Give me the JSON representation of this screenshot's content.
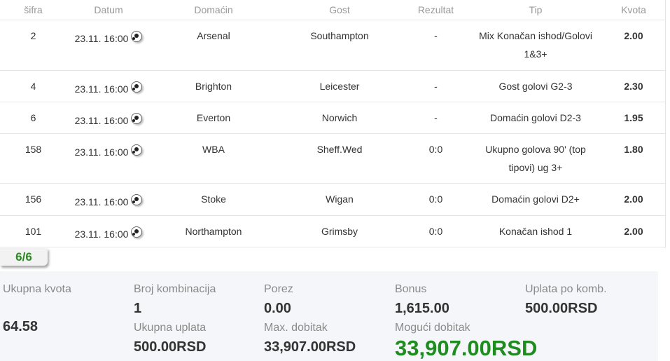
{
  "table": {
    "headers": [
      "šifra",
      "Datum",
      "Domaćin",
      "Gost",
      "Rezultat",
      "Tip",
      "Kvota"
    ],
    "rows": [
      {
        "code": "2",
        "date": "23.11. 16:00",
        "home": "Arsenal",
        "away": "Southampton",
        "result": "-",
        "tip": "Mix Konačan ishod/Golovi 1&3+",
        "odds": "2.00"
      },
      {
        "code": "4",
        "date": "23.11. 16:00",
        "home": "Brighton",
        "away": "Leicester",
        "result": "-",
        "tip": "Gost golovi G2-3",
        "odds": "2.30"
      },
      {
        "code": "6",
        "date": "23.11. 16:00",
        "home": "Everton",
        "away": "Norwich",
        "result": "-",
        "tip": "Domaćin golovi D2-3",
        "odds": "1.95"
      },
      {
        "code": "158",
        "date": "23.11. 16:00",
        "home": "WBA",
        "away": "Sheff.Wed",
        "result": "0:0",
        "tip": "Ukupno golova 90' (top tipovi) ug 3+",
        "odds": "1.80"
      },
      {
        "code": "156",
        "date": "23.11. 16:00",
        "home": "Stoke",
        "away": "Wigan",
        "result": "0:0",
        "tip": "Domaćin golovi D2+",
        "odds": "2.00"
      },
      {
        "code": "101",
        "date": "23.11. 16:00",
        "home": "Northampton",
        "away": "Grimsby",
        "result": "0:0",
        "tip": "Konačan ishod 1",
        "odds": "2.00"
      }
    ]
  },
  "counter": "6/6",
  "summary": {
    "total_odds_label": "Ukupna kvota",
    "total_odds_value": "64.58",
    "combinations_label": "Broj kombinacija",
    "combinations_value": "1",
    "tax_label": "Porez",
    "tax_value": "0.00",
    "bonus_label": "Bonus",
    "bonus_value": "1,615.00",
    "stake_per_comb_label": "Uplata po komb.",
    "stake_per_comb_value": "500.00RSD",
    "total_stake_label": "Ukupna uplata",
    "total_stake_value": "500.00RSD",
    "max_win_label": "Max. dobitak",
    "max_win_value": "33,907.00RSD",
    "possible_win_label": "Mogući dobitak",
    "possible_win_value": "33,907.00RSD"
  },
  "colors": {
    "accent_green": "#1e8c1e",
    "summary_bg": "#f4f6f9"
  },
  "icons": {
    "sport": "soccer-ball-icon"
  }
}
